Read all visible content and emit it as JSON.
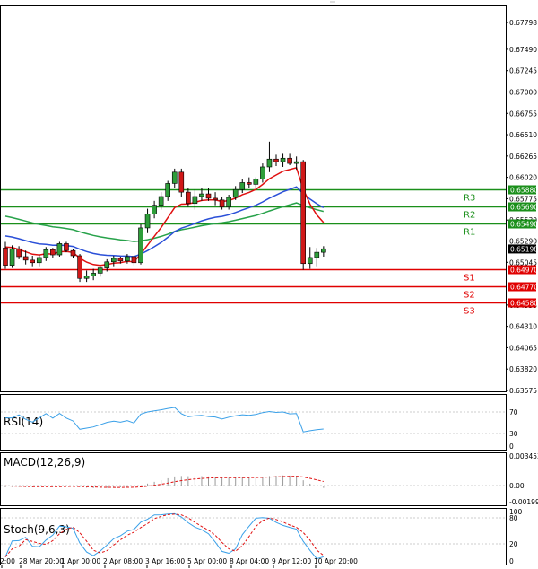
{
  "colors": {
    "bull": "#2e9e3a",
    "bear": "#d01818",
    "support": "#e00000",
    "resistance": "#1a8f1a",
    "current_price_bg": "#000000",
    "ma_fast": "#e01010",
    "ma_mid": "#2a4fd8",
    "ma_slow": "#27a24a",
    "indicator_line": "#3aa0e8",
    "signal_line": "#e01010",
    "grid": "#cccccc"
  },
  "price_axis": {
    "ticks": [
      "0.67798",
      "0.67490",
      "0.67245",
      "0.67000",
      "0.66755",
      "0.66510",
      "0.66265",
      "0.66020",
      "0.65775",
      "0.65530",
      "0.65290",
      "0.65045",
      "0.64555",
      "0.64310",
      "0.64065",
      "0.63820",
      "0.63575"
    ]
  },
  "levels": [
    {
      "name": "R3",
      "value": "0.65880",
      "type": "resistance"
    },
    {
      "name": "R2",
      "value": "0.65690",
      "type": "resistance"
    },
    {
      "name": "R1",
      "value": "0.65490",
      "type": "resistance"
    },
    {
      "name": "S1",
      "value": "0.64970",
      "type": "support"
    },
    {
      "name": "S2",
      "value": "0.64770",
      "type": "support"
    },
    {
      "name": "S3",
      "value": "0.64580",
      "type": "support"
    }
  ],
  "current_price": "0.65198",
  "time_axis": [
    "2:00",
    "28 Mar 20:00",
    "1 Apr 00:00",
    "2 Apr 08:00",
    "3 Apr 16:00",
    "5 Apr 00:00",
    "8 Apr 04:00",
    "9 Apr 12:00",
    "10 Apr 20:00"
  ],
  "indicators": {
    "rsi": {
      "title": "RSI(14)",
      "ticks": [
        "70",
        "30",
        "0"
      ]
    },
    "macd": {
      "title": "MACD(12,26,9)",
      "ticks": [
        "0.003453",
        "0.00",
        "-0.001999"
      ]
    },
    "stoch": {
      "title": "Stoch(9,6,3)",
      "ticks": [
        "100",
        "80",
        "20",
        "0"
      ]
    }
  },
  "chart_data": {
    "type": "candlestick",
    "candles_ohlc": [
      [
        0.6521,
        0.6528,
        0.6497,
        0.6501
      ],
      [
        0.6501,
        0.6524,
        0.6498,
        0.652
      ],
      [
        0.652,
        0.6523,
        0.6508,
        0.6511
      ],
      [
        0.6511,
        0.6518,
        0.6502,
        0.6507
      ],
      [
        0.6507,
        0.6512,
        0.65,
        0.6504
      ],
      [
        0.6504,
        0.6513,
        0.65,
        0.651
      ],
      [
        0.651,
        0.6522,
        0.6506,
        0.6519
      ],
      [
        0.6519,
        0.6521,
        0.651,
        0.6513
      ],
      [
        0.6513,
        0.6528,
        0.6511,
        0.6526
      ],
      [
        0.6526,
        0.6528,
        0.6516,
        0.6518
      ],
      [
        0.6518,
        0.652,
        0.651,
        0.6512
      ],
      [
        0.6512,
        0.6514,
        0.6482,
        0.6486
      ],
      [
        0.6486,
        0.6495,
        0.6482,
        0.6489
      ],
      [
        0.6489,
        0.6497,
        0.6484,
        0.6492
      ],
      [
        0.6492,
        0.65,
        0.6488,
        0.6498
      ],
      [
        0.6498,
        0.6508,
        0.6494,
        0.6505
      ],
      [
        0.6505,
        0.6512,
        0.65,
        0.6509
      ],
      [
        0.6509,
        0.6511,
        0.6503,
        0.6506
      ],
      [
        0.6506,
        0.6514,
        0.6503,
        0.6511
      ],
      [
        0.6511,
        0.6512,
        0.6501,
        0.6504
      ],
      [
        0.6504,
        0.6548,
        0.6502,
        0.6544
      ],
      [
        0.6544,
        0.6566,
        0.6538,
        0.656
      ],
      [
        0.656,
        0.6575,
        0.6555,
        0.657
      ],
      [
        0.657,
        0.6585,
        0.6565,
        0.658
      ],
      [
        0.658,
        0.6598,
        0.6575,
        0.6595
      ],
      [
        0.6595,
        0.6612,
        0.659,
        0.6608
      ],
      [
        0.6608,
        0.6612,
        0.658,
        0.6585
      ],
      [
        0.6585,
        0.659,
        0.6568,
        0.6572
      ],
      [
        0.6572,
        0.6588,
        0.6565,
        0.658
      ],
      [
        0.658,
        0.659,
        0.6575,
        0.6583
      ],
      [
        0.6583,
        0.659,
        0.6575,
        0.6578
      ],
      [
        0.6578,
        0.6585,
        0.657,
        0.6576
      ],
      [
        0.6576,
        0.658,
        0.6565,
        0.6568
      ],
      [
        0.6568,
        0.6582,
        0.6565,
        0.6579
      ],
      [
        0.6579,
        0.6592,
        0.6576,
        0.6588
      ],
      [
        0.6588,
        0.66,
        0.6584,
        0.6596
      ],
      [
        0.6596,
        0.6602,
        0.659,
        0.6594
      ],
      [
        0.6594,
        0.6602,
        0.659,
        0.66
      ],
      [
        0.66,
        0.6618,
        0.6596,
        0.6614
      ],
      [
        0.6614,
        0.6643,
        0.6608,
        0.6623
      ],
      [
        0.6623,
        0.6628,
        0.6615,
        0.662
      ],
      [
        0.662,
        0.6629,
        0.6614,
        0.6624
      ],
      [
        0.6624,
        0.6629,
        0.6616,
        0.6618
      ],
      [
        0.6618,
        0.6626,
        0.6611,
        0.662
      ],
      [
        0.662,
        0.6622,
        0.6496,
        0.6503
      ],
      [
        0.6503,
        0.6522,
        0.6497,
        0.651
      ],
      [
        0.651,
        0.6521,
        0.65,
        0.6516
      ],
      [
        0.6516,
        0.6523,
        0.6511,
        0.652
      ]
    ]
  }
}
